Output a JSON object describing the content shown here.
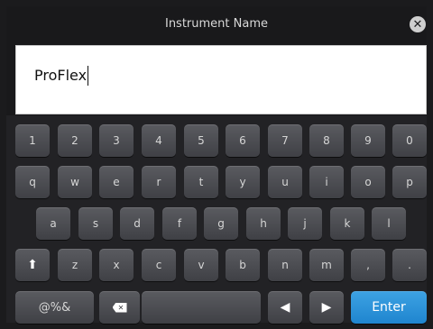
{
  "dialog": {
    "title": "Instrument Name"
  },
  "field": {
    "value": "ProFlex"
  },
  "keyboard": {
    "row1": [
      "1",
      "2",
      "3",
      "4",
      "5",
      "6",
      "7",
      "8",
      "9",
      "0"
    ],
    "row2": [
      "q",
      "w",
      "e",
      "r",
      "t",
      "y",
      "u",
      "i",
      "o",
      "p"
    ],
    "row3": [
      "a",
      "s",
      "d",
      "f",
      "g",
      "h",
      "j",
      "k",
      "l"
    ],
    "row4": [
      "z",
      "x",
      "c",
      "v",
      "b",
      "n",
      "m",
      ",",
      "."
    ],
    "symbols_label": "@%&",
    "enter_label": "Enter"
  },
  "icons": {
    "close": "close-icon",
    "shift": "shift-icon",
    "backspace": "backspace-icon",
    "left": "arrow-left-icon",
    "right": "arrow-right-icon"
  },
  "colors": {
    "enter": "#2c96dc",
    "key": "#4b4c51",
    "background": "#19191b"
  }
}
